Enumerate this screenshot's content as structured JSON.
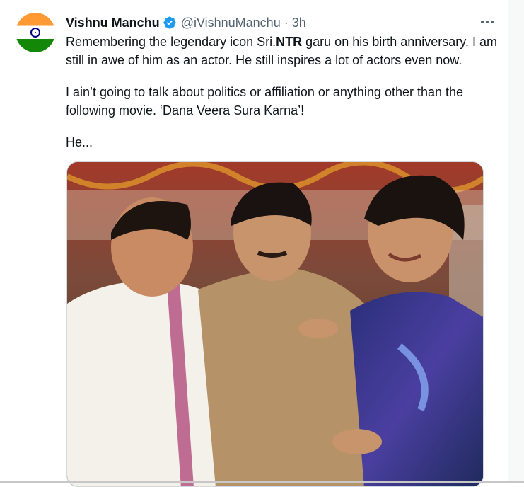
{
  "tweet": {
    "author_name": "Vishnu Manchu",
    "handle": "@iVishnuManchu",
    "separator": "·",
    "time": "3h",
    "line1_before": "Remembering the legendary icon Sri.",
    "line1_bold": "NTR",
    "line1_after": " garu on his birth anniversary. I am still in awe of him as an actor. He still inspires a lot of actors even now.",
    "paragraph2": "I ain’t going to talk about politics or affiliation or anything other than the following movie. ‘Dana Veera Sura Karna’!",
    "paragraph3": "He..."
  },
  "colors": {
    "verified_badge": "#1d9bf0",
    "secondary_text": "#536471",
    "flag_saffron": "#ff9933",
    "flag_green": "#138808",
    "chakra": "#000080"
  },
  "icons": {
    "avatar": "india-flag-avatar",
    "verified": "verified-badge-icon",
    "more": "more-options-icon"
  }
}
